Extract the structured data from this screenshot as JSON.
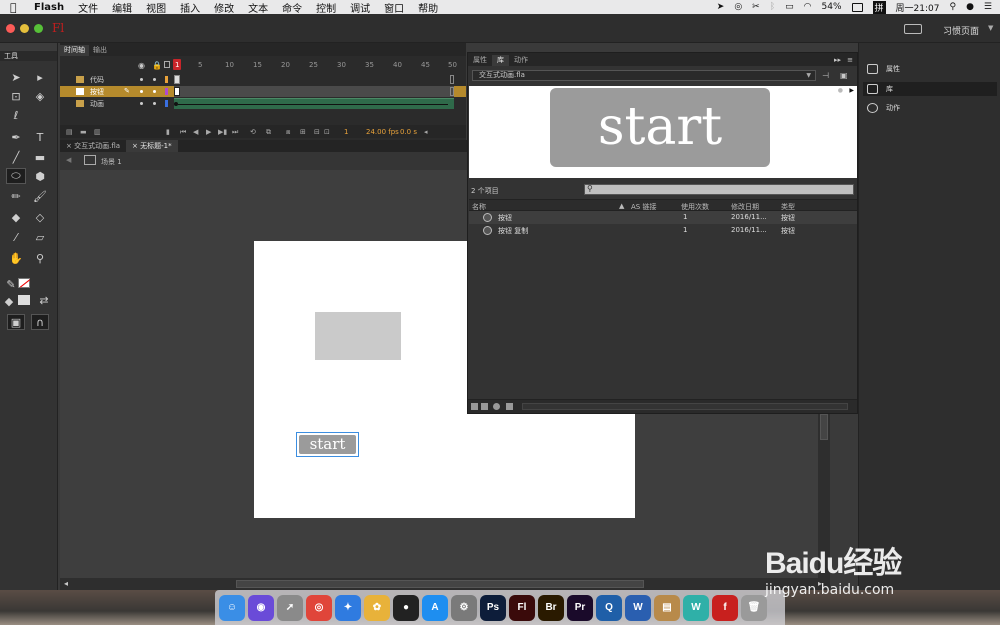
{
  "menubar": {
    "app": "Flash",
    "items": [
      "文件",
      "编辑",
      "视图",
      "插入",
      "修改",
      "文本",
      "命令",
      "控制",
      "调试",
      "窗口",
      "帮助"
    ],
    "battery": "54%",
    "clock": "周一21:07"
  },
  "titlebar": {
    "logo": "Fl",
    "workspace": "习惯页面"
  },
  "tools": {
    "title": "工具"
  },
  "timeline": {
    "tabs": [
      "时间轴",
      "输出"
    ],
    "frame_numbers": [
      "1",
      "5",
      "10",
      "15",
      "20",
      "25",
      "30",
      "35",
      "40",
      "45",
      "50"
    ],
    "layers": [
      {
        "name": "代码",
        "color": "#e8a23a"
      },
      {
        "name": "按钮",
        "color": "#b04ad0"
      },
      {
        "name": "动画",
        "color": "#3a6fe0"
      }
    ],
    "current_frame": "1",
    "fps": "24.00 fps",
    "time": "0.0 s"
  },
  "documents": {
    "tabs": [
      "交互式动画.fla",
      "无标题-1*"
    ],
    "scene": "场景 1"
  },
  "stage": {
    "button_label": "start"
  },
  "library": {
    "tabs": [
      "属性",
      "库",
      "动作"
    ],
    "file": "交互式动画.fla",
    "preview_label": "start",
    "count": "2 个项目",
    "columns": [
      "名称",
      "AS 链接",
      "使用次数",
      "修改日期",
      "类型"
    ],
    "rows": [
      {
        "name": "按钮",
        "uses": "1",
        "date": "2016/11...",
        "type": "按钮"
      },
      {
        "name": "按钮 复制",
        "uses": "1",
        "date": "2016/11...",
        "type": "按钮"
      }
    ]
  },
  "right_dock": {
    "items": [
      "属性",
      "库",
      "动作"
    ]
  },
  "dock": {
    "apps": [
      {
        "name": "finder",
        "color": "#3a8ee6",
        "glyph": "☺"
      },
      {
        "name": "siri",
        "color": "#6a4bd8",
        "glyph": "◉"
      },
      {
        "name": "launchpad",
        "color": "#8a8a8a",
        "glyph": "➚"
      },
      {
        "name": "chrome",
        "color": "#e0453a",
        "glyph": "◎"
      },
      {
        "name": "safari",
        "color": "#2f7be0",
        "glyph": "✦"
      },
      {
        "name": "photos",
        "color": "#e8b23a",
        "glyph": "✿"
      },
      {
        "name": "qq",
        "color": "#222222",
        "glyph": "●"
      },
      {
        "name": "app-store",
        "color": "#1e8ef0",
        "glyph": "A"
      },
      {
        "name": "system-preferences",
        "color": "#7a7a7a",
        "glyph": "⚙"
      },
      {
        "name": "photoshop",
        "color": "#0d1d3a",
        "glyph": "Ps"
      },
      {
        "name": "flash",
        "color": "#3a0a0a",
        "glyph": "Fl"
      },
      {
        "name": "bridge",
        "color": "#2a1a00",
        "glyph": "Br"
      },
      {
        "name": "premiere",
        "color": "#1a0a2a",
        "glyph": "Pr"
      },
      {
        "name": "quicktime",
        "color": "#1f5fa8",
        "glyph": "Q"
      },
      {
        "name": "word",
        "color": "#2a5fb0",
        "glyph": "W"
      },
      {
        "name": "archive",
        "color": "#b88a4a",
        "glyph": "▤"
      },
      {
        "name": "wunderlist",
        "color": "#2fb0a8",
        "glyph": "W"
      },
      {
        "name": "flash-player",
        "color": "#c8201e",
        "glyph": "f"
      },
      {
        "name": "trash",
        "color": "#9a9a9a",
        "glyph": "🗑"
      }
    ]
  },
  "watermark": {
    "brand": "Baidu经验",
    "url": "jingyan.baidu.com"
  }
}
